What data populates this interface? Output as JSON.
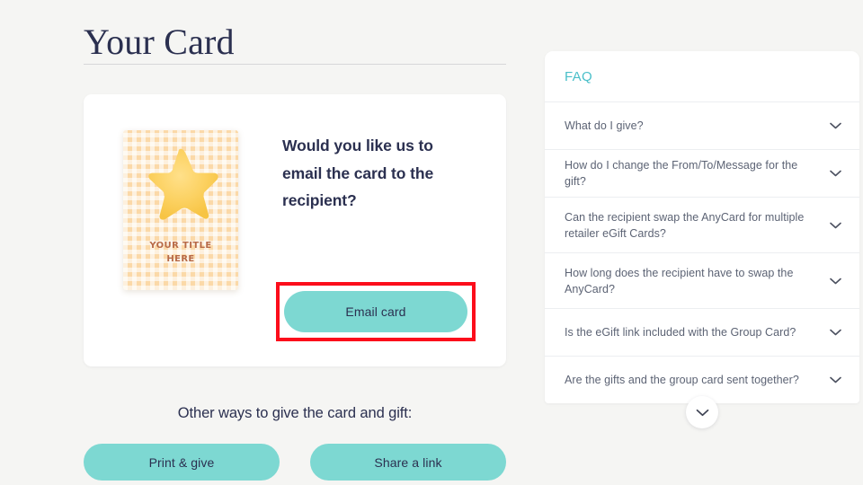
{
  "page": {
    "title": "Your Card",
    "background_color": "#f5f5f3"
  },
  "card_panel": {
    "preview": {
      "title_line1": "YOUR TITLE",
      "title_line2": "HERE",
      "art_icon": "star-icon",
      "pattern": "orange-gingham",
      "star_color": "#fbcf53",
      "title_text_color": "#b86a46"
    },
    "question": "Would you like us to email the card to the recipient?",
    "primary_button": {
      "label": "Email card",
      "background_color": "#7dd8d2",
      "text_color": "#2b3050",
      "highlighted": true,
      "highlight_color": "#fc0d1b"
    }
  },
  "other_ways": {
    "label": "Other ways to give the card and gift:",
    "buttons": [
      {
        "label": "Print & give"
      },
      {
        "label": "Share a link"
      }
    ]
  },
  "faq": {
    "header": "FAQ",
    "header_color": "#49bfc9",
    "expand_icon": "chevron-down-icon",
    "items": [
      {
        "question": "What do I give?",
        "expanded": false
      },
      {
        "question": "How do I change the From/To/Message for the gift?",
        "expanded": false
      },
      {
        "question": "Can the recipient swap the AnyCard for multiple retailer eGift Cards?",
        "expanded": false
      },
      {
        "question": "How long does the recipient have to swap the AnyCard?",
        "expanded": false
      },
      {
        "question": "Is the eGift link included with the Group Card?",
        "expanded": false
      },
      {
        "question": "Are the gifts and the group card sent together?",
        "expanded": false
      }
    ],
    "show_more_icon": "chevron-down-icon"
  }
}
